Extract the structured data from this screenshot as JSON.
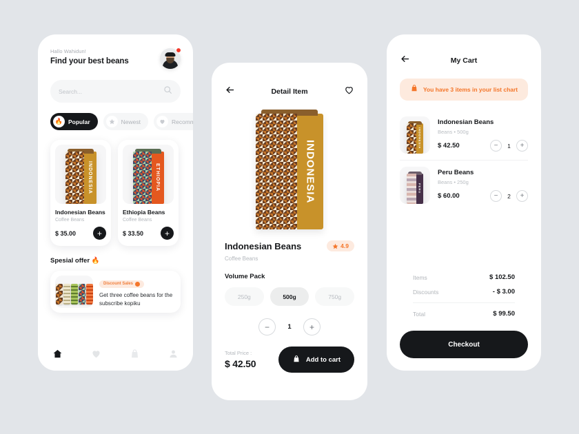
{
  "background_color": "#e2e5e9",
  "accent_color": "#f4762a",
  "dark_color": "#16181b",
  "home": {
    "greeting_small": "Hallo Wahidun!",
    "greeting_title": "Find your best beans",
    "avatar_name": "avatar",
    "search": {
      "placeholder": "Search...",
      "value": ""
    },
    "chips": [
      {
        "label": "Popular",
        "icon": "flame-icon",
        "active": true
      },
      {
        "label": "Newest",
        "icon": "star-icon",
        "active": false
      },
      {
        "label": "Recommend",
        "icon": "heart-icon",
        "active": false
      }
    ],
    "products": [
      {
        "title": "Indonesian Beans",
        "subtitle": "Coffee Beans",
        "price": "$ 35.00",
        "add_label": "+",
        "panel_text": "INDONESIA"
      },
      {
        "title": "Ethiopia Beans",
        "subtitle": "Coffee Beans",
        "price": "$ 33.50",
        "add_label": "+",
        "panel_text": "ETHIOPIA"
      }
    ],
    "offer_heading": "Spesial offer 🔥",
    "offer": {
      "badge": "Discount Sales",
      "text": "Get three coffee beans for the subscribe kopiku"
    },
    "nav": [
      {
        "icon": "home-icon",
        "active": true
      },
      {
        "icon": "heart-icon",
        "active": false
      },
      {
        "icon": "bag-icon",
        "active": false
      },
      {
        "icon": "person-icon",
        "active": false
      }
    ]
  },
  "detail": {
    "back_icon": "arrow-left-icon",
    "title": "Detail Item",
    "favorite_icon": "heart-outline-icon",
    "hero_panel_text": "INDONESIA",
    "product_name": "Indonesian Beans",
    "rating": "4.9",
    "rating_icon": "star-icon",
    "subtitle": "Coffee Beans",
    "volume_label": "Volume Pack",
    "volumes": [
      {
        "label": "250g",
        "selected": false
      },
      {
        "label": "500g",
        "selected": true
      },
      {
        "label": "750g",
        "selected": false
      }
    ],
    "quantity": "1",
    "decrement_label": "−",
    "increment_label": "+",
    "total_label": "Total Price :",
    "total_value": "$ 42.50",
    "add_to_cart_label": "Add to cart",
    "add_to_cart_icon": "bag-icon"
  },
  "cart": {
    "back_icon": "arrow-left-icon",
    "title": "My Cart",
    "notice_icon": "bag-icon",
    "notice_text": "You have 3 items in your list chart",
    "items": [
      {
        "name": "Indonesian Beans",
        "meta": "Beans  •  500g",
        "price": "$ 42.50",
        "quantity": "1",
        "panel_text": "INDONESIA"
      },
      {
        "name": "Peru Beans",
        "meta": "Beans  •  250g",
        "price": "$ 60.00",
        "quantity": "2",
        "panel_text": "PERU"
      }
    ],
    "decrement_label": "−",
    "increment_label": "+",
    "summary": [
      {
        "label": "Items",
        "value": "$ 102.50"
      },
      {
        "label": "Discounts",
        "value": "- $ 3.00"
      }
    ],
    "total_label": "Total",
    "total_value": "$ 99.50",
    "checkout_label": "Checkout"
  }
}
